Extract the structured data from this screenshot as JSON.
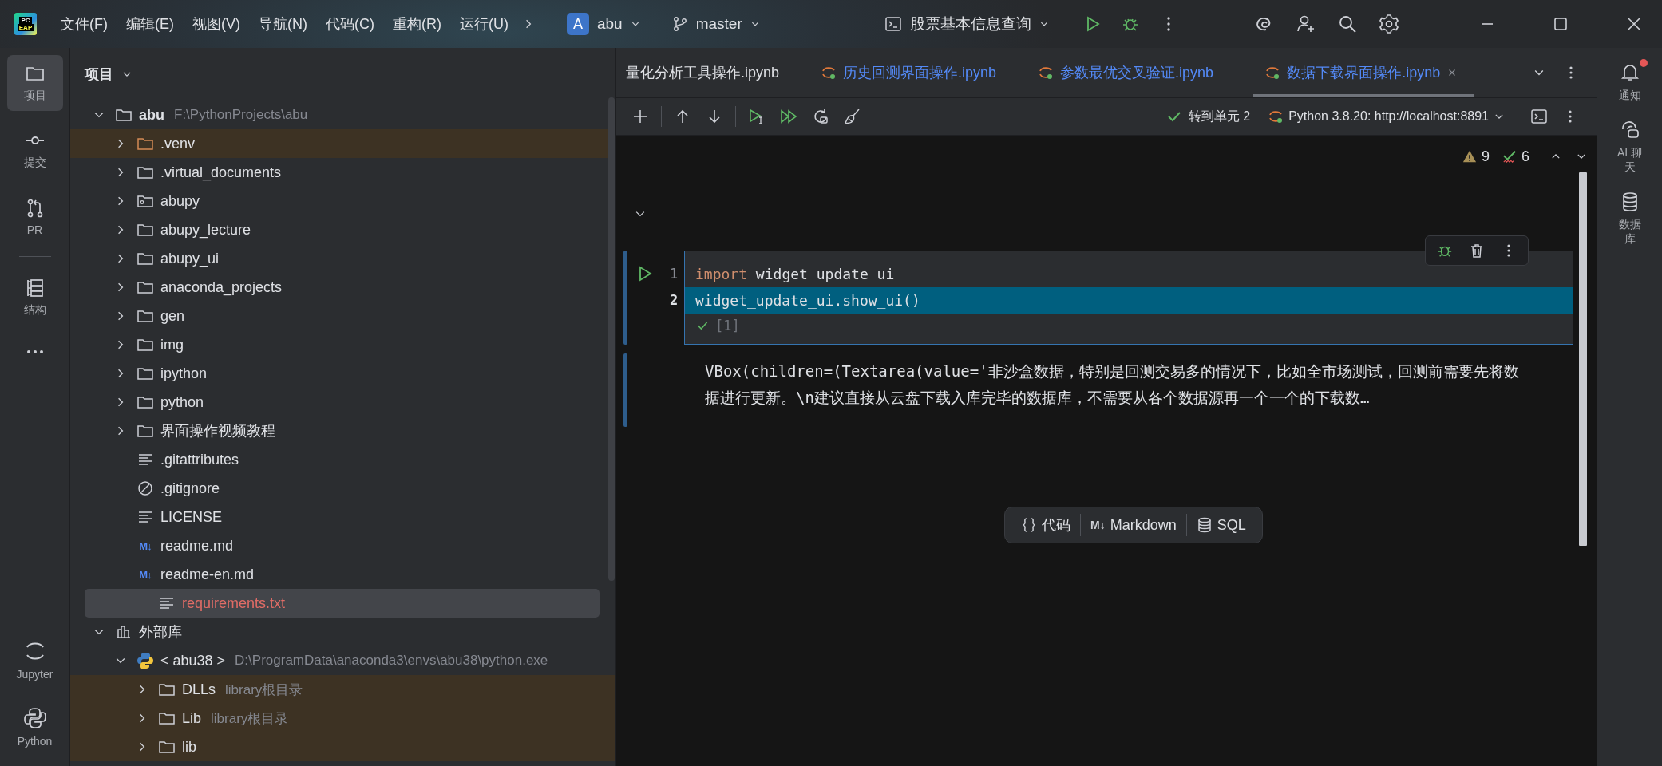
{
  "title_bar": {
    "logo": {
      "top": "PC",
      "bottom": "EAP"
    },
    "menu": [
      "文件(F)",
      "编辑(E)",
      "视图(V)",
      "导航(N)",
      "代码(C)",
      "重构(R)",
      "运行(U)"
    ],
    "project": {
      "avatar": "A",
      "name": "abu"
    },
    "branch": "master",
    "run_config": "股票基本信息查询"
  },
  "left_toolbar": {
    "top_groups": [
      [
        {
          "label": "项目",
          "kind": "folder",
          "selected": true
        },
        {
          "label": "提交",
          "kind": "commit",
          "selected": false
        },
        {
          "label": "PR",
          "kind": "pull-request",
          "selected": false
        }
      ],
      [
        {
          "label": "结构",
          "kind": "structure",
          "selected": false
        }
      ]
    ],
    "bottom": [
      {
        "label": "Jupyter",
        "kind": "jupyter",
        "selected": false
      },
      {
        "label": "Python",
        "kind": "python",
        "selected": false
      }
    ]
  },
  "project_panel": {
    "title": "项目",
    "tree": [
      {
        "label": "abu",
        "path": "F:\\PythonProjects\\abu",
        "kind": "folder",
        "expanded": true,
        "highlighted": false,
        "selected": false,
        "unversioned": false,
        "children": [
          {
            "label": ".venv",
            "kind": "excluded-folder",
            "expanded": false,
            "highlighted": true,
            "selected": false,
            "unversioned": false
          },
          {
            "label": ".virtual_documents",
            "kind": "folder",
            "expanded": false,
            "highlighted": false,
            "selected": false,
            "unversioned": false
          },
          {
            "label": "abupy",
            "kind": "package-folder",
            "expanded": false,
            "highlighted": false,
            "selected": false,
            "unversioned": false
          },
          {
            "label": "abupy_lecture",
            "kind": "folder",
            "expanded": false,
            "highlighted": false,
            "selected": false,
            "unversioned": false
          },
          {
            "label": "abupy_ui",
            "kind": "folder",
            "expanded": false,
            "highlighted": false,
            "selected": false,
            "unversioned": false
          },
          {
            "label": "anaconda_projects",
            "kind": "folder",
            "expanded": false,
            "highlighted": false,
            "selected": false,
            "unversioned": false
          },
          {
            "label": "gen",
            "kind": "folder",
            "expanded": false,
            "highlighted": false,
            "selected": false,
            "unversioned": false
          },
          {
            "label": "img",
            "kind": "folder",
            "expanded": false,
            "highlighted": false,
            "selected": false,
            "unversioned": false
          },
          {
            "label": "ipython",
            "kind": "folder",
            "expanded": false,
            "highlighted": false,
            "selected": false,
            "unversioned": false
          },
          {
            "label": "python",
            "kind": "folder",
            "expanded": false,
            "highlighted": false,
            "selected": false,
            "unversioned": false
          },
          {
            "label": "界面操作视频教程",
            "kind": "folder",
            "expanded": false,
            "highlighted": false,
            "selected": false,
            "unversioned": false
          },
          {
            "label": ".gitattributes",
            "kind": "text-file",
            "highlighted": false,
            "selected": false,
            "unversioned": false
          },
          {
            "label": ".gitignore",
            "kind": "ignore-file",
            "highlighted": false,
            "selected": false,
            "unversioned": false
          },
          {
            "label": "LICENSE",
            "kind": "text-file",
            "highlighted": false,
            "selected": false,
            "unversioned": false
          },
          {
            "label": "readme.md",
            "kind": "markdown-file",
            "badge": "M↓",
            "highlighted": false,
            "selected": false,
            "unversioned": false
          },
          {
            "label": "readme-en.md",
            "kind": "markdown-file",
            "badge": "M↓",
            "highlighted": false,
            "selected": false,
            "unversioned": false
          },
          {
            "label": "requirements.txt",
            "kind": "text-file",
            "highlighted": false,
            "selected": true,
            "unversioned": true
          }
        ]
      },
      {
        "label": "外部库",
        "kind": "library",
        "expanded": true,
        "highlighted": false,
        "selected": false,
        "unversioned": false,
        "children": [
          {
            "label": "< abu38 >",
            "path": "D:\\ProgramData\\anaconda3\\envs\\abu38\\python.exe",
            "kind": "python-sdk",
            "expanded": true,
            "highlighted": false,
            "selected": false,
            "unversioned": false,
            "children": [
              {
                "label": "DLLs",
                "path": "library根目录",
                "kind": "folder",
                "expanded": false,
                "highlighted": true,
                "selected": false,
                "unversioned": false
              },
              {
                "label": "Lib",
                "path": "library根目录",
                "kind": "folder",
                "expanded": false,
                "highlighted": true,
                "selected": false,
                "unversioned": false
              },
              {
                "label": "lib",
                "kind": "folder",
                "expanded": false,
                "highlighted": true,
                "selected": false,
                "unversioned": false
              }
            ]
          }
        ]
      }
    ]
  },
  "editor": {
    "tabs": [
      {
        "label": "量化分析工具操作.ipynb",
        "jupyter_icon": false,
        "modified": false,
        "selected": false
      },
      {
        "label": "历史回测界面操作.ipynb",
        "jupyter_icon": true,
        "modified": true,
        "selected": false
      },
      {
        "label": "参数最优交叉验证.ipynb",
        "jupyter_icon": true,
        "modified": true,
        "selected": false
      },
      {
        "label": "数据下载界面操作.ipynb",
        "jupyter_icon": true,
        "modified": true,
        "selected": true
      }
    ],
    "toolbar": {
      "goto_cell": "转到单元 2",
      "kernel": "Python 3.8.20: http://localhost:8891"
    },
    "inspections": {
      "warnings": "9",
      "checks": "6"
    },
    "cell": {
      "lines": [
        {
          "number": "1",
          "current": false,
          "tokens": [
            {
              "text": "import",
              "kind": "keyword"
            },
            {
              "text": " widget_update_ui",
              "kind": "plain"
            }
          ]
        },
        {
          "number": "2",
          "current": true,
          "tokens": [
            {
              "text": "widget_update_ui.show_ui()",
              "kind": "plain"
            }
          ]
        }
      ],
      "execution_count": "[1]",
      "output": "VBox(children=(Textarea(value='非沙盒数据，特别是回测交易多的情况下，比如全市场测试，回测前需要先将数据进行更新。\\n建议直接从云盘下载入库完毕的数据库，不需要从各个数据源再一个一个的下载数…"
    },
    "cell_types": [
      {
        "kind": "code",
        "label": "代码"
      },
      {
        "kind": "markdown",
        "badge": "M↓",
        "label": "Markdown"
      },
      {
        "kind": "sql",
        "label": "SQL"
      }
    ]
  },
  "right_toolbar": [
    {
      "label": "通知",
      "kind": "bell",
      "unread": true
    },
    {
      "label": "AI 聊天",
      "kind": "ai-chat",
      "unread": false
    },
    {
      "label": "数据库",
      "kind": "database",
      "unread": false
    }
  ]
}
